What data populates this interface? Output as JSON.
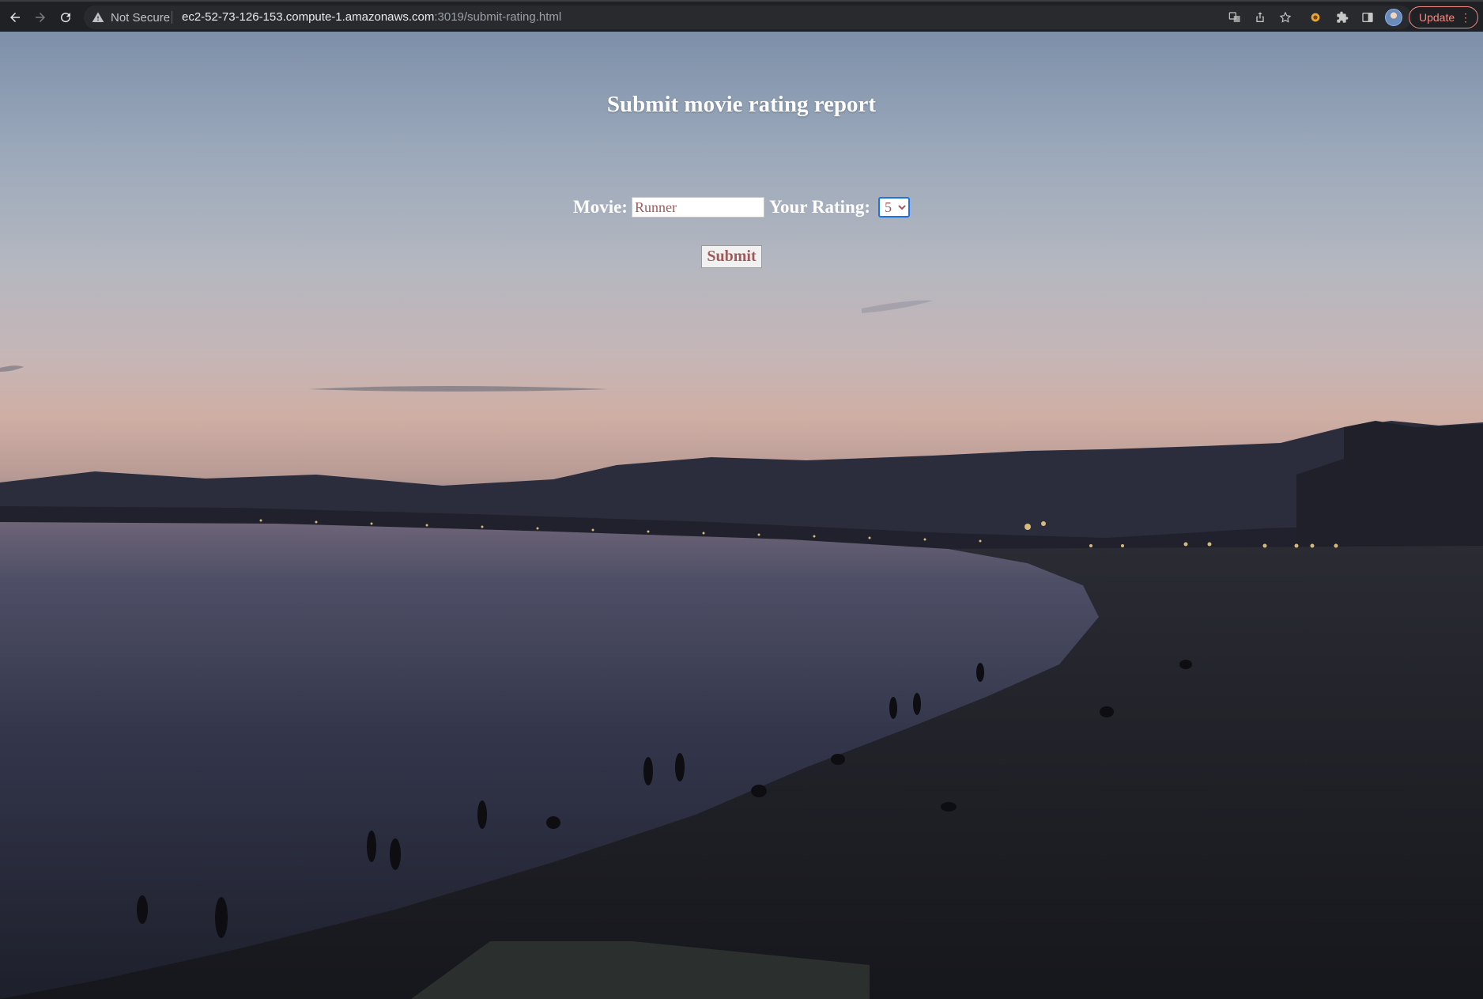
{
  "browser": {
    "security_label": "Not Secure",
    "url_host": "ec2-52-73-126-153.compute-1.amazonaws.com",
    "url_rest": ":3019/submit-rating.html",
    "update_label": "Update",
    "menu_glyph": "⋮",
    "icons": [
      "back-arrow-icon",
      "forward-arrow-icon",
      "reload-icon",
      "warning-triangle-icon",
      "translate-icon",
      "share-icon",
      "bookmark-star-icon",
      "extension-icon",
      "puzzle-icon",
      "side-panel-icon",
      "profile-avatar-icon"
    ]
  },
  "page": {
    "title": "Submit movie rating report",
    "movie_label": "Movie:",
    "movie_value": "Runner",
    "rating_label": "Your Rating:",
    "rating_selected": "5",
    "submit_label": "Submit",
    "background": "sunset beach photo"
  },
  "colors": {
    "chrome_bg": "#202124",
    "update_accent": "#f28b82",
    "field_text": "#a05a5a",
    "focus_ring": "#1a73e8"
  }
}
